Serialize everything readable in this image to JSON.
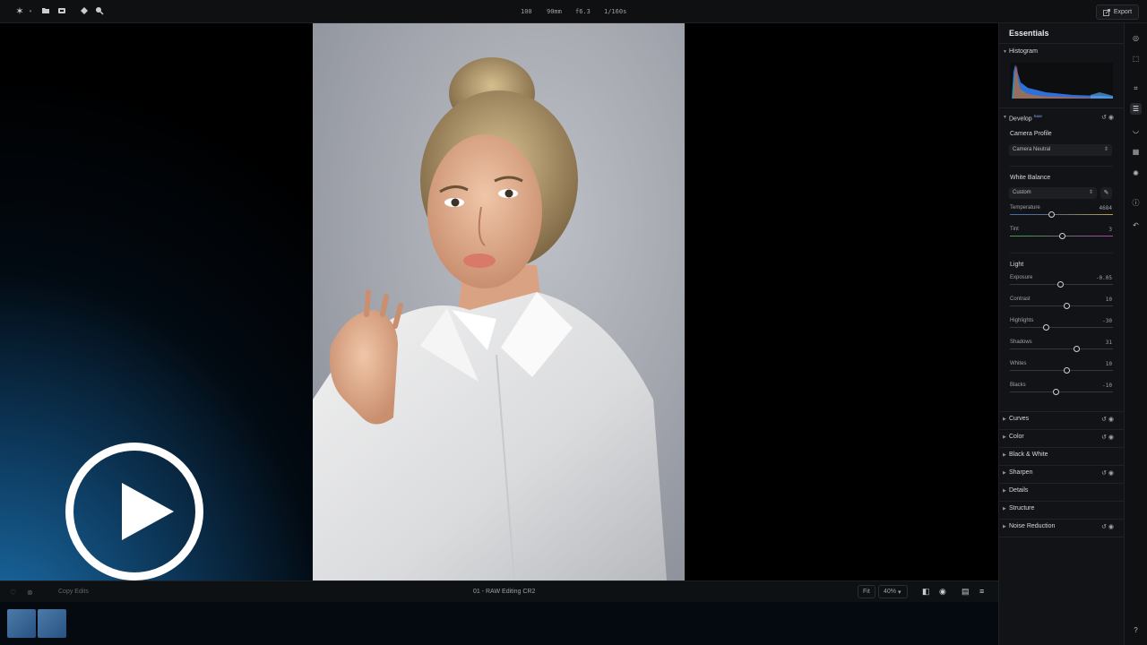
{
  "toolbar": {
    "icons": [
      "app-logo-icon",
      "folder-icon",
      "import-icon",
      "tag-icon",
      "search-icon"
    ],
    "exif": {
      "iso": "100",
      "focal": "90mm",
      "aperture": "f6.3",
      "shutter": "1/160s"
    },
    "export_label": "Export"
  },
  "viewport": {
    "filename": "01 - RAW Editing CR2",
    "copy_edits_label": "Copy Edits",
    "fit_label": "Fit",
    "zoom_value": "40%"
  },
  "panel": {
    "title": "Essentials",
    "histogram_label": "Histogram",
    "develop": {
      "label": "Develop",
      "badge": "RAW",
      "camera_profile_label": "Camera Profile",
      "camera_profile_value": "Camera Neutral",
      "white_balance_label": "White Balance",
      "white_balance_value": "Custom",
      "light_label": "Light",
      "sliders_wb": [
        {
          "label": "Temperature",
          "value": "4684",
          "pos": 0.4,
          "track": "temperature"
        },
        {
          "label": "Tint",
          "value": "3",
          "pos": 0.51,
          "track": "tint"
        }
      ],
      "sliders_light": [
        {
          "label": "Exposure",
          "value": "-0.05",
          "pos": 0.49
        },
        {
          "label": "Contrast",
          "value": "10",
          "pos": 0.55
        },
        {
          "label": "Highlights",
          "value": "-30",
          "pos": 0.35
        },
        {
          "label": "Shadows",
          "value": "31",
          "pos": 0.65
        },
        {
          "label": "Whites",
          "value": "10",
          "pos": 0.55
        },
        {
          "label": "Blacks",
          "value": "-10",
          "pos": 0.45
        }
      ]
    },
    "sections": [
      {
        "label": "Curves",
        "icons": true
      },
      {
        "label": "Color",
        "icons": true
      },
      {
        "label": "Black & White",
        "icons": false
      },
      {
        "label": "Sharpen",
        "icons": true
      },
      {
        "label": "Details",
        "icons": false
      },
      {
        "label": "Structure",
        "icons": false
      },
      {
        "label": "Noise Reduction",
        "icons": true
      }
    ]
  },
  "rail": {
    "icons": [
      "layers-icon",
      "selection-icon",
      "crop-icon",
      "adjust-icon",
      "mask-icon",
      "template-icon",
      "effects-icon",
      "info-icon",
      "history-icon",
      "help-icon"
    ]
  },
  "colors": {
    "accent": "#1e78b9",
    "panel": "#121316",
    "background": "#000000"
  }
}
